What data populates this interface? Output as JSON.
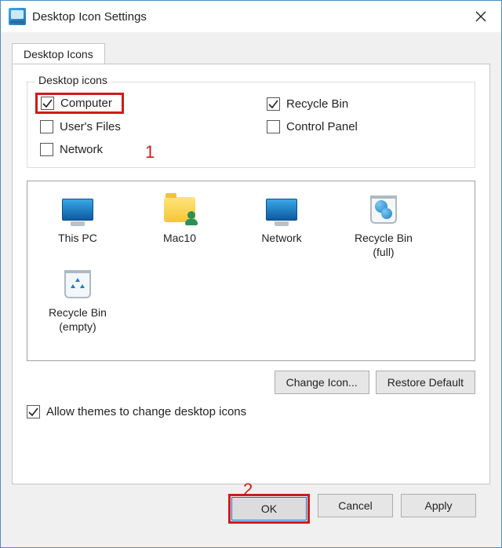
{
  "window": {
    "title": "Desktop Icon Settings"
  },
  "tab": {
    "label": "Desktop Icons"
  },
  "group": {
    "label": "Desktop icons"
  },
  "checks": {
    "computer": {
      "label": "Computer",
      "checked": true
    },
    "recycle_bin": {
      "label": "Recycle Bin",
      "checked": true
    },
    "users_files": {
      "label": "User's Files",
      "checked": false
    },
    "control_panel": {
      "label": "Control Panel",
      "checked": false
    },
    "network": {
      "label": "Network",
      "checked": false
    }
  },
  "icons": {
    "this_pc": "This PC",
    "user_folder": "Mac10",
    "network": "Network",
    "recycle_full": "Recycle Bin (full)",
    "recycle_empty": "Recycle Bin (empty)"
  },
  "buttons": {
    "change_icon": "Change Icon...",
    "restore_default": "Restore Default",
    "ok": "OK",
    "cancel": "Cancel",
    "apply": "Apply"
  },
  "themes": {
    "label": "Allow themes to change desktop icons",
    "checked": true
  },
  "annotations": {
    "one": "1",
    "two": "2"
  }
}
